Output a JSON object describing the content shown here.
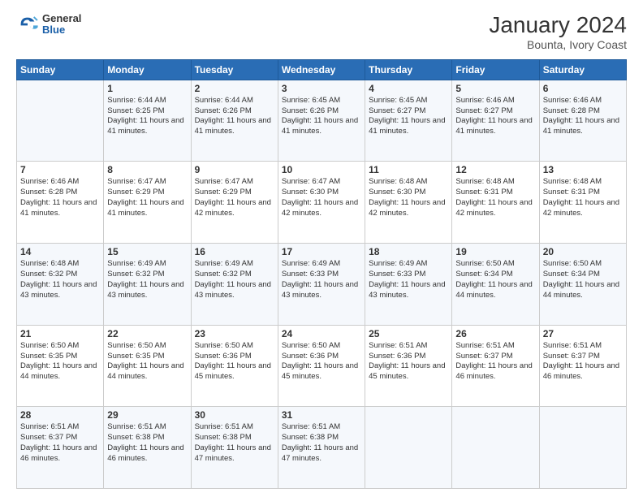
{
  "header": {
    "logo": {
      "line1": "General",
      "line2": "Blue"
    },
    "title": "January 2024",
    "subtitle": "Bounta, Ivory Coast"
  },
  "weekdays": [
    "Sunday",
    "Monday",
    "Tuesday",
    "Wednesday",
    "Thursday",
    "Friday",
    "Saturday"
  ],
  "weeks": [
    [
      {
        "day": "",
        "sunrise": "",
        "sunset": "",
        "daylight": ""
      },
      {
        "day": "1",
        "sunrise": "Sunrise: 6:44 AM",
        "sunset": "Sunset: 6:25 PM",
        "daylight": "Daylight: 11 hours and 41 minutes."
      },
      {
        "day": "2",
        "sunrise": "Sunrise: 6:44 AM",
        "sunset": "Sunset: 6:26 PM",
        "daylight": "Daylight: 11 hours and 41 minutes."
      },
      {
        "day": "3",
        "sunrise": "Sunrise: 6:45 AM",
        "sunset": "Sunset: 6:26 PM",
        "daylight": "Daylight: 11 hours and 41 minutes."
      },
      {
        "day": "4",
        "sunrise": "Sunrise: 6:45 AM",
        "sunset": "Sunset: 6:27 PM",
        "daylight": "Daylight: 11 hours and 41 minutes."
      },
      {
        "day": "5",
        "sunrise": "Sunrise: 6:46 AM",
        "sunset": "Sunset: 6:27 PM",
        "daylight": "Daylight: 11 hours and 41 minutes."
      },
      {
        "day": "6",
        "sunrise": "Sunrise: 6:46 AM",
        "sunset": "Sunset: 6:28 PM",
        "daylight": "Daylight: 11 hours and 41 minutes."
      }
    ],
    [
      {
        "day": "7",
        "sunrise": "Sunrise: 6:46 AM",
        "sunset": "Sunset: 6:28 PM",
        "daylight": "Daylight: 11 hours and 41 minutes."
      },
      {
        "day": "8",
        "sunrise": "Sunrise: 6:47 AM",
        "sunset": "Sunset: 6:29 PM",
        "daylight": "Daylight: 11 hours and 41 minutes."
      },
      {
        "day": "9",
        "sunrise": "Sunrise: 6:47 AM",
        "sunset": "Sunset: 6:29 PM",
        "daylight": "Daylight: 11 hours and 42 minutes."
      },
      {
        "day": "10",
        "sunrise": "Sunrise: 6:47 AM",
        "sunset": "Sunset: 6:30 PM",
        "daylight": "Daylight: 11 hours and 42 minutes."
      },
      {
        "day": "11",
        "sunrise": "Sunrise: 6:48 AM",
        "sunset": "Sunset: 6:30 PM",
        "daylight": "Daylight: 11 hours and 42 minutes."
      },
      {
        "day": "12",
        "sunrise": "Sunrise: 6:48 AM",
        "sunset": "Sunset: 6:31 PM",
        "daylight": "Daylight: 11 hours and 42 minutes."
      },
      {
        "day": "13",
        "sunrise": "Sunrise: 6:48 AM",
        "sunset": "Sunset: 6:31 PM",
        "daylight": "Daylight: 11 hours and 42 minutes."
      }
    ],
    [
      {
        "day": "14",
        "sunrise": "Sunrise: 6:48 AM",
        "sunset": "Sunset: 6:32 PM",
        "daylight": "Daylight: 11 hours and 43 minutes."
      },
      {
        "day": "15",
        "sunrise": "Sunrise: 6:49 AM",
        "sunset": "Sunset: 6:32 PM",
        "daylight": "Daylight: 11 hours and 43 minutes."
      },
      {
        "day": "16",
        "sunrise": "Sunrise: 6:49 AM",
        "sunset": "Sunset: 6:32 PM",
        "daylight": "Daylight: 11 hours and 43 minutes."
      },
      {
        "day": "17",
        "sunrise": "Sunrise: 6:49 AM",
        "sunset": "Sunset: 6:33 PM",
        "daylight": "Daylight: 11 hours and 43 minutes."
      },
      {
        "day": "18",
        "sunrise": "Sunrise: 6:49 AM",
        "sunset": "Sunset: 6:33 PM",
        "daylight": "Daylight: 11 hours and 43 minutes."
      },
      {
        "day": "19",
        "sunrise": "Sunrise: 6:50 AM",
        "sunset": "Sunset: 6:34 PM",
        "daylight": "Daylight: 11 hours and 44 minutes."
      },
      {
        "day": "20",
        "sunrise": "Sunrise: 6:50 AM",
        "sunset": "Sunset: 6:34 PM",
        "daylight": "Daylight: 11 hours and 44 minutes."
      }
    ],
    [
      {
        "day": "21",
        "sunrise": "Sunrise: 6:50 AM",
        "sunset": "Sunset: 6:35 PM",
        "daylight": "Daylight: 11 hours and 44 minutes."
      },
      {
        "day": "22",
        "sunrise": "Sunrise: 6:50 AM",
        "sunset": "Sunset: 6:35 PM",
        "daylight": "Daylight: 11 hours and 44 minutes."
      },
      {
        "day": "23",
        "sunrise": "Sunrise: 6:50 AM",
        "sunset": "Sunset: 6:36 PM",
        "daylight": "Daylight: 11 hours and 45 minutes."
      },
      {
        "day": "24",
        "sunrise": "Sunrise: 6:50 AM",
        "sunset": "Sunset: 6:36 PM",
        "daylight": "Daylight: 11 hours and 45 minutes."
      },
      {
        "day": "25",
        "sunrise": "Sunrise: 6:51 AM",
        "sunset": "Sunset: 6:36 PM",
        "daylight": "Daylight: 11 hours and 45 minutes."
      },
      {
        "day": "26",
        "sunrise": "Sunrise: 6:51 AM",
        "sunset": "Sunset: 6:37 PM",
        "daylight": "Daylight: 11 hours and 46 minutes."
      },
      {
        "day": "27",
        "sunrise": "Sunrise: 6:51 AM",
        "sunset": "Sunset: 6:37 PM",
        "daylight": "Daylight: 11 hours and 46 minutes."
      }
    ],
    [
      {
        "day": "28",
        "sunrise": "Sunrise: 6:51 AM",
        "sunset": "Sunset: 6:37 PM",
        "daylight": "Daylight: 11 hours and 46 minutes."
      },
      {
        "day": "29",
        "sunrise": "Sunrise: 6:51 AM",
        "sunset": "Sunset: 6:38 PM",
        "daylight": "Daylight: 11 hours and 46 minutes."
      },
      {
        "day": "30",
        "sunrise": "Sunrise: 6:51 AM",
        "sunset": "Sunset: 6:38 PM",
        "daylight": "Daylight: 11 hours and 47 minutes."
      },
      {
        "day": "31",
        "sunrise": "Sunrise: 6:51 AM",
        "sunset": "Sunset: 6:38 PM",
        "daylight": "Daylight: 11 hours and 47 minutes."
      },
      {
        "day": "",
        "sunrise": "",
        "sunset": "",
        "daylight": ""
      },
      {
        "day": "",
        "sunrise": "",
        "sunset": "",
        "daylight": ""
      },
      {
        "day": "",
        "sunrise": "",
        "sunset": "",
        "daylight": ""
      }
    ]
  ]
}
